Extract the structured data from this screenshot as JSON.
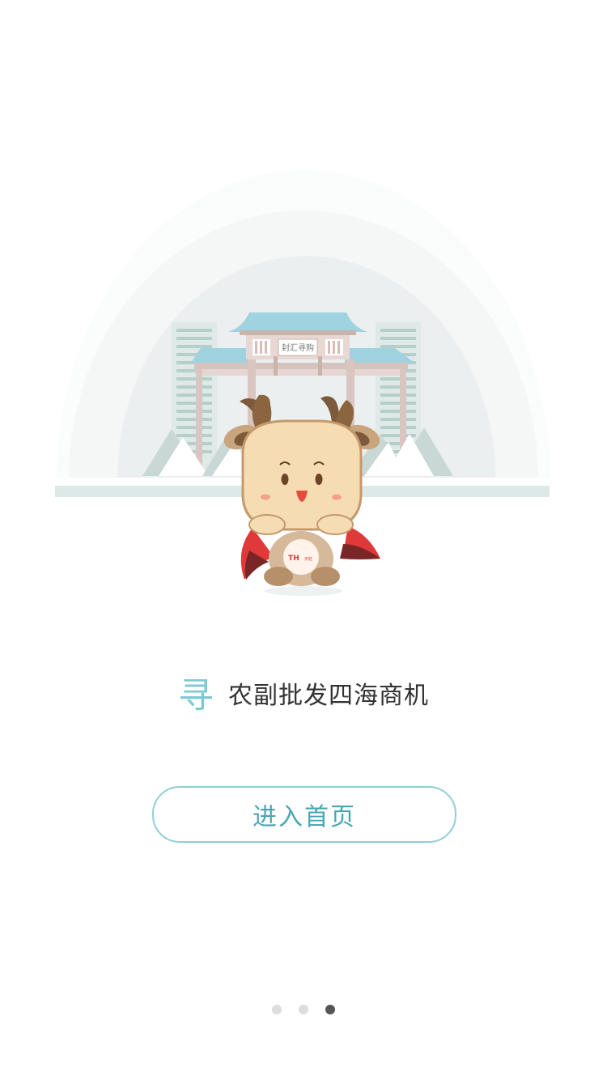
{
  "slogan": {
    "highlight": "寻",
    "text": "农副批发四海商机"
  },
  "enter_button": {
    "label": "进入首页"
  },
  "illustration": {
    "gate_plaque": "封汇寻购",
    "badge_text": "TH",
    "badge_subtext": "天虹"
  },
  "pager": {
    "total": 3,
    "active_index": 2
  },
  "colors": {
    "accent": "#7ec8d3",
    "button_text": "#4aa6b3",
    "dot_active": "#555555",
    "dot_inactive": "#dddddd"
  }
}
